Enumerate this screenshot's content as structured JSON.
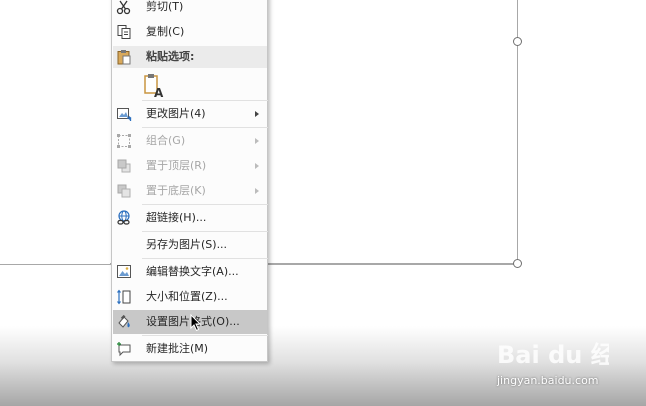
{
  "menu": {
    "cut": "剪切(T)",
    "copy": "复制(C)",
    "paste_header": "粘贴选项:",
    "change_picture": "更改图片(4)",
    "group": "组合(G)",
    "bring_to_front": "置于顶层(R)",
    "send_to_back": "置于底层(K)",
    "hyperlink": "超链接(H)...",
    "save_as_picture": "另存为图片(S)...",
    "edit_alt_text": "编辑替换文字(A)...",
    "size_position": "大小和位置(Z)...",
    "format_picture": "设置图片格式(O)...",
    "new_comment": "新建批注(M)"
  },
  "watermark": {
    "brand": "Bai du 经验",
    "url": "jingyan.baidu.com"
  },
  "icons": {
    "cut": "scissors-icon",
    "copy": "copy-icon",
    "paste": "clipboard-icon",
    "paste_option": "keep-text-only-icon",
    "change_picture": "change-picture-icon",
    "group": "group-icon",
    "bring_to_front": "bring-to-front-icon",
    "send_to_back": "send-to-back-icon",
    "hyperlink": "hyperlink-icon",
    "edit_alt_text": "alt-text-icon",
    "size_position": "size-position-icon",
    "format_picture": "format-picture-icon",
    "new_comment": "new-comment-icon"
  },
  "colors": {
    "menu_bg": "#fcfcfc",
    "highlight": "#c8c8c8",
    "header_bg": "#ebebeb",
    "disabled_text": "#a6a6a6"
  }
}
